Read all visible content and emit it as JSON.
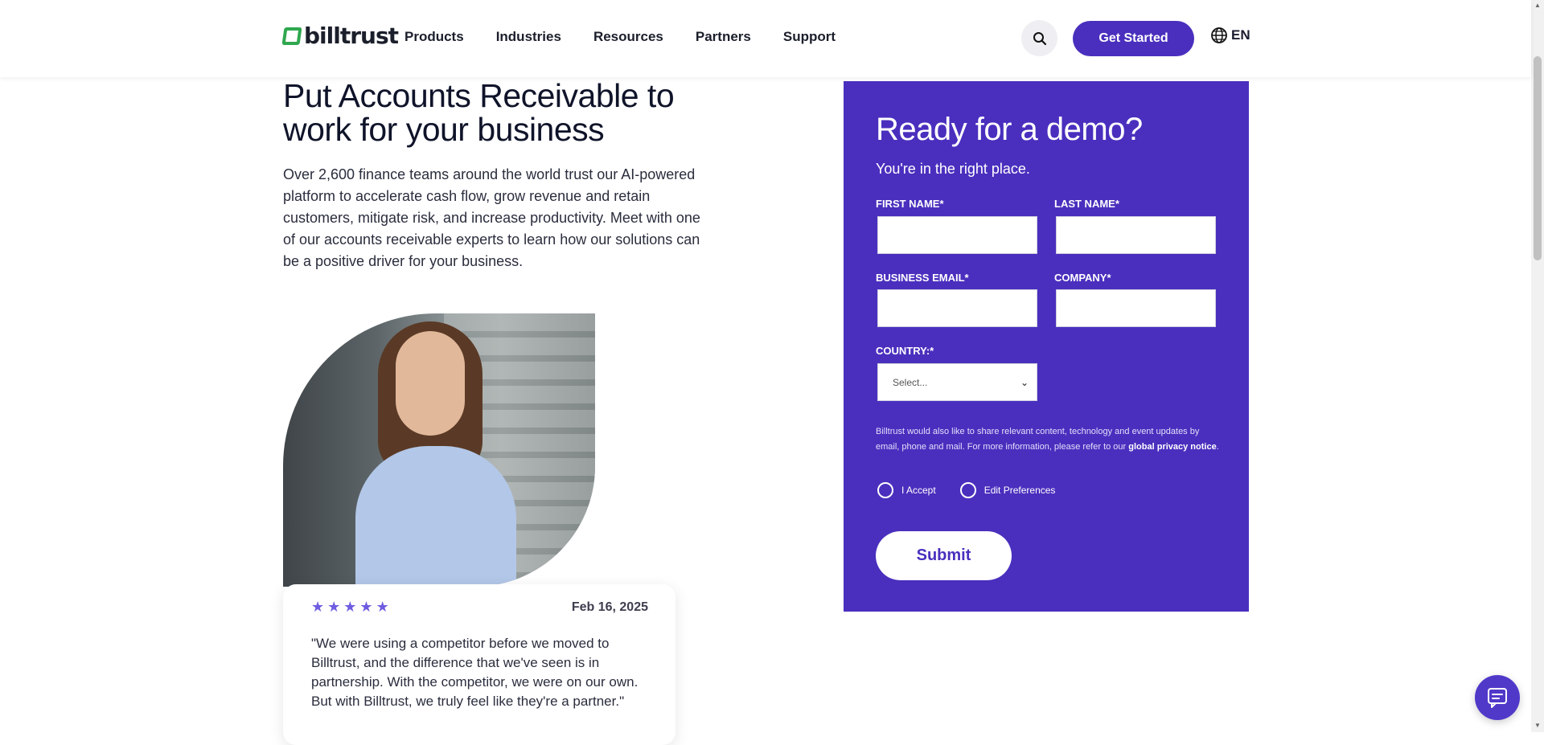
{
  "header": {
    "logo_text": "billtrust",
    "nav": [
      "Products",
      "Industries",
      "Resources",
      "Partners",
      "Support"
    ],
    "cta_label": "Get Started",
    "language": "EN"
  },
  "hero": {
    "title": "Put Accounts Receivable to work for your business",
    "body": "Over 2,600 finance teams around the world trust our AI-powered platform to accelerate cash flow, grow revenue and retain customers, mitigate risk, and increase productivity. Meet with one of our accounts receivable experts to learn how our solutions can be a positive driver for your business."
  },
  "review": {
    "stars": [
      "★",
      "★",
      "★",
      "★",
      "★"
    ],
    "rating": 5,
    "date": "Feb 16, 2025",
    "quote": "\"We were using a competitor before we moved to Billtrust, and the difference that we've seen is in partnership. With the competitor, we were on our own. But with Billtrust, we truly feel like they're a partner.\""
  },
  "form": {
    "title": "Ready for a demo?",
    "subtitle": "You're in the right place.",
    "first_name_label": "FIRST NAME*",
    "last_name_label": "LAST NAME*",
    "email_label": "BUSINESS EMAIL*",
    "company_label": "COMPANY*",
    "country_label": "COUNTRY:*",
    "country_value": "Select...",
    "consent_text": "Billtrust would also like to share relevant content, technology and event updates by email, phone and mail. For more information, please refer to our",
    "consent_link": "global privacy notice",
    "consent_end": ".",
    "accept_label": "I Accept",
    "preferences_label": "Edit Preferences",
    "submit_label": "Submit"
  },
  "colors": {
    "brand_purple": "#4a2fbe",
    "logo_green": "#2fa84f",
    "star": "#6e5ce0"
  },
  "icons": {
    "search": "search-icon",
    "globe": "globe-icon",
    "chat": "chat-icon"
  }
}
